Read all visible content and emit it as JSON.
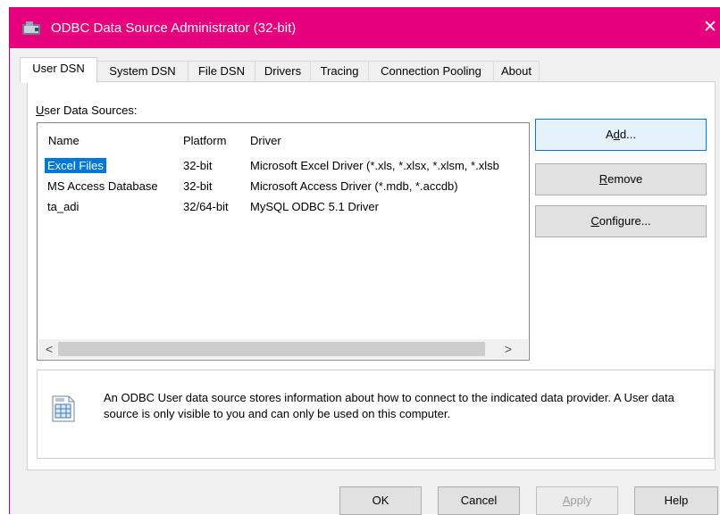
{
  "window": {
    "title": "ODBC Data Source Administrator (32-bit)",
    "close_label": "✕",
    "accent_color": "#e6007e"
  },
  "tabs": [
    {
      "label": "User DSN",
      "active": true
    },
    {
      "label": "System DSN"
    },
    {
      "label": "File DSN"
    },
    {
      "label": "Drivers"
    },
    {
      "label": "Tracing"
    },
    {
      "label": "Connection Pooling"
    },
    {
      "label": "About"
    }
  ],
  "user_dsn": {
    "group_label_first": "U",
    "group_label_rest": "ser Data Sources:",
    "columns": [
      "Name",
      "Platform",
      "Driver"
    ],
    "rows": [
      {
        "name": "Excel Files",
        "platform": "32-bit",
        "driver": "Microsoft Excel Driver (*.xls, *.xlsx, *.xlsm, *.xlsb",
        "selected": true
      },
      {
        "name": "MS Access Database",
        "platform": "32-bit",
        "driver": "Microsoft Access Driver (*.mdb, *.accdb)"
      },
      {
        "name": "ta_adi",
        "platform": "32/64-bit",
        "driver": "MySQL ODBC 5.1 Driver"
      }
    ],
    "scroll_left": "<",
    "scroll_right": ">"
  },
  "side_buttons": {
    "add_pre": "A",
    "add_u": "d",
    "add_post": "d...",
    "remove_u": "R",
    "remove_post": "emove",
    "configure_u": "C",
    "configure_post": "onfigure..."
  },
  "info": {
    "text": "An ODBC User data source stores information about how to connect to the indicated data provider.   A User data source is only visible to you and can only be used on this computer.",
    "icon": "database-info-icon"
  },
  "footer": {
    "ok": "OK",
    "cancel": "Cancel",
    "apply_u": "A",
    "apply_post": "pply",
    "help": "Help"
  }
}
